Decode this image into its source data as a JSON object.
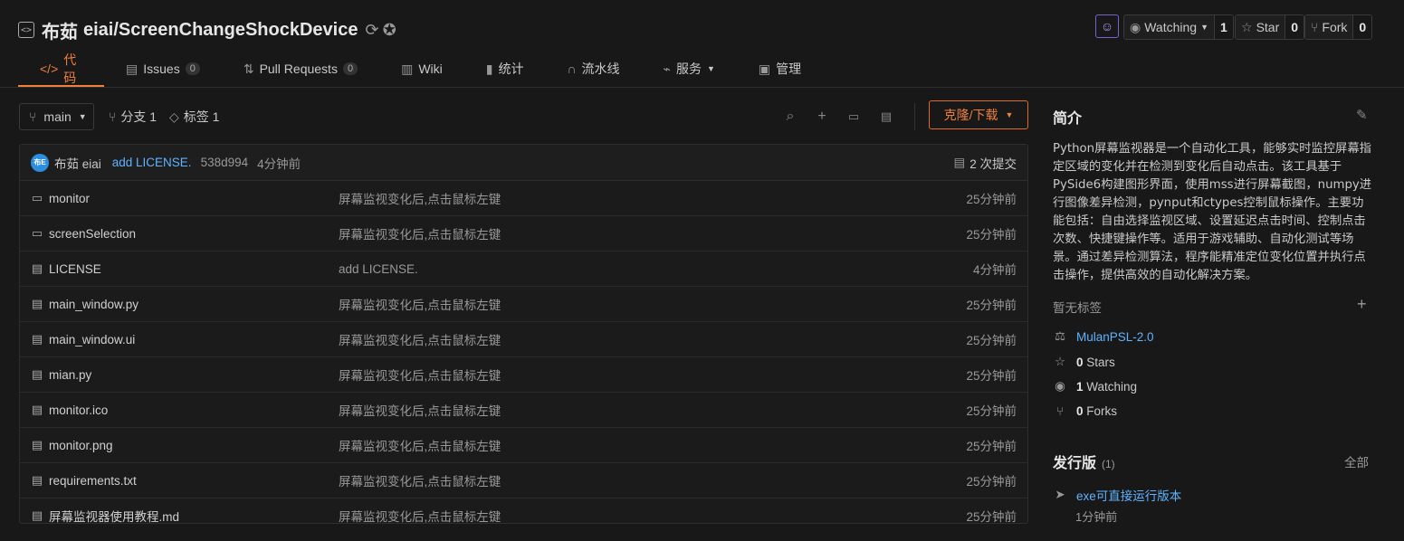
{
  "repo": {
    "owner": "布茹",
    "name": "eiai/ScreenChangeShockDevice"
  },
  "actions": {
    "watching_label": "Watching",
    "watching_count": "1",
    "star_label": "Star",
    "star_count": "0",
    "fork_label": "Fork",
    "fork_count": "0"
  },
  "tabs": [
    {
      "label": "代码",
      "icon": "code-icon",
      "active": true
    },
    {
      "label": "Issues",
      "badge": "0",
      "icon": "issues-icon"
    },
    {
      "label": "Pull Requests",
      "badge": "0",
      "icon": "pull-request-icon"
    },
    {
      "label": "Wiki",
      "icon": "book-icon"
    },
    {
      "label": "统计",
      "icon": "stats-icon"
    },
    {
      "label": "流水线",
      "icon": "pipeline-icon"
    },
    {
      "label": "服务",
      "icon": "pulse-icon"
    },
    {
      "label": "管理",
      "icon": "manage-icon"
    }
  ],
  "toolbar": {
    "branch": "main",
    "branches_label": "分支 1",
    "tags_label": "标签 1",
    "clone_label": "克隆/下载"
  },
  "commit": {
    "avatar_text": "布E",
    "author": "布茹 eiai",
    "message": "add LICENSE.",
    "hash": "538d994",
    "time": "4分钟前",
    "count_label": "2 次提交"
  },
  "files": [
    {
      "name": "monitor",
      "type": "folder",
      "message": "屏幕监视变化后,点击鼠标左键",
      "time": "25分钟前"
    },
    {
      "name": "screenSelection",
      "type": "folder",
      "message": "屏幕监视变化后,点击鼠标左键",
      "time": "25分钟前"
    },
    {
      "name": "LICENSE",
      "type": "file",
      "message": "add LICENSE.",
      "time": "4分钟前"
    },
    {
      "name": "main_window.py",
      "type": "file",
      "message": "屏幕监视变化后,点击鼠标左键",
      "time": "25分钟前"
    },
    {
      "name": "main_window.ui",
      "type": "file",
      "message": "屏幕监视变化后,点击鼠标左键",
      "time": "25分钟前"
    },
    {
      "name": "mian.py",
      "type": "file",
      "message": "屏幕监视变化后,点击鼠标左键",
      "time": "25分钟前"
    },
    {
      "name": "monitor.ico",
      "type": "file",
      "message": "屏幕监视变化后,点击鼠标左键",
      "time": "25分钟前"
    },
    {
      "name": "monitor.png",
      "type": "file",
      "message": "屏幕监视变化后,点击鼠标左键",
      "time": "25分钟前"
    },
    {
      "name": "requirements.txt",
      "type": "file",
      "message": "屏幕监视变化后,点击鼠标左键",
      "time": "25分钟前"
    },
    {
      "name": "屏幕监视器使用教程.md",
      "type": "file",
      "message": "屏幕监视变化后,点击鼠标左键",
      "time": "25分钟前"
    }
  ],
  "sidebar": {
    "intro_title": "简介",
    "description": "Python屏幕监视器是一个自动化工具，能够实时监控屏幕指定区域的变化并在检测到变化后自动点击。该工具基于PySide6构建图形界面，使用mss进行屏幕截图，numpy进行图像差异检测，pynput和ctypes控制鼠标操作。主要功能包括：自由选择监视区域、设置延迟点击时间、控制点击次数、快捷键操作等。适用于游戏辅助、自动化测试等场景。通过差异检测算法，程序能精准定位变化位置并执行点击操作，提供高效的自动化解决方案。",
    "no_tags": "暂无标签",
    "license": "MulanPSL-2.0",
    "stars_num": "0",
    "stars_label": "Stars",
    "watching_num": "1",
    "watching_label": "Watching",
    "forks_num": "0",
    "forks_label": "Forks",
    "releases_title": "发行版",
    "releases_count": "(1)",
    "releases_all": "全部",
    "release_name": "exe可直接运行版本",
    "release_time": "1分钟前"
  },
  "colors": {
    "accent": "#f07f3c",
    "link": "#5fb3ff",
    "background": "#181818"
  }
}
